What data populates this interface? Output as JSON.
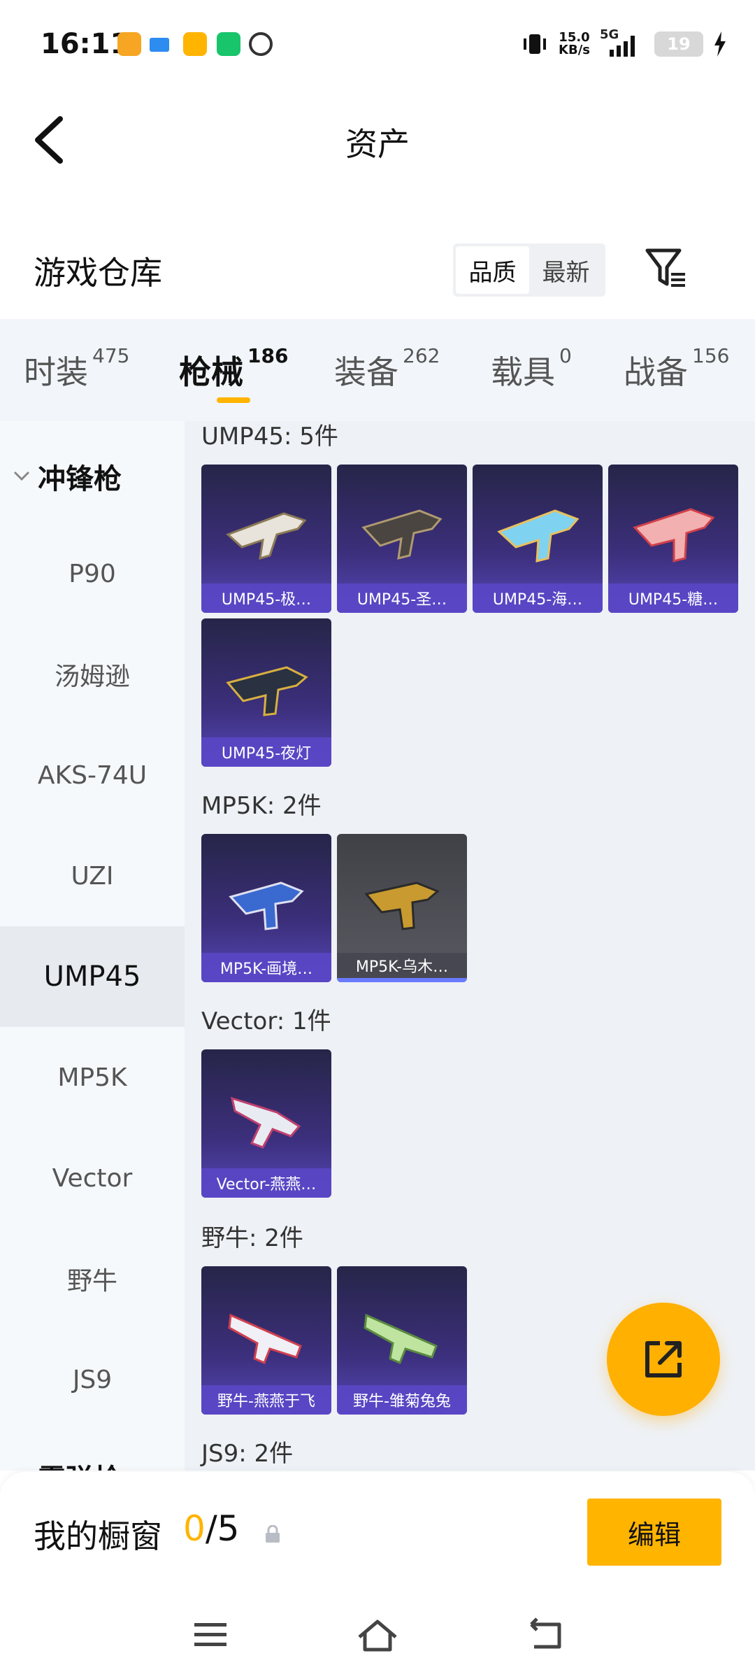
{
  "status_bar": {
    "time": "16:11",
    "net_speed": "15.0",
    "net_unit": "KB/s",
    "network": "5G",
    "battery": "19"
  },
  "header": {
    "title": "资产"
  },
  "warehouse": {
    "title": "游戏仓库",
    "sort_options": [
      "品质",
      "最新"
    ],
    "sort_active": "品质"
  },
  "tabs": [
    {
      "label": "时装",
      "count": "475"
    },
    {
      "label": "枪械",
      "count": "186"
    },
    {
      "label": "装备",
      "count": "262"
    },
    {
      "label": "载具",
      "count": "0"
    },
    {
      "label": "战备",
      "count": "156"
    }
  ],
  "sidebar": {
    "category": "冲锋枪",
    "items": [
      "P90",
      "汤姆逊",
      "AKS-74U",
      "UZI",
      "UMP45",
      "MP5K",
      "Vector",
      "野牛",
      "JS9"
    ],
    "active": "UMP45",
    "next_category_partial": "霰弹枪"
  },
  "groups": [
    {
      "title": "UMP45: 5件",
      "items": [
        "UMP45-极…",
        "UMP45-圣…",
        "UMP45-海…",
        "UMP45-糖…",
        "UMP45-夜灯"
      ]
    },
    {
      "title": "MP5K: 2件",
      "items": [
        "MP5K-画境…",
        "MP5K-乌木…"
      ]
    },
    {
      "title": "Vector: 1件",
      "items": [
        "Vector-燕燕…"
      ]
    },
    {
      "title": "野牛: 2件",
      "items": [
        "野牛-燕燕于飞",
        "野牛-雏菊兔兔"
      ]
    },
    {
      "title": "JS9: 2件",
      "items": []
    }
  ],
  "showcase": {
    "label": "我的橱窗",
    "current": "0",
    "total": "/5",
    "edit_label": "编辑"
  },
  "colors": {
    "accent": "#ffb400",
    "card_purple": "#3c2f7c",
    "sidebar_bg": "#f6f9fc"
  }
}
